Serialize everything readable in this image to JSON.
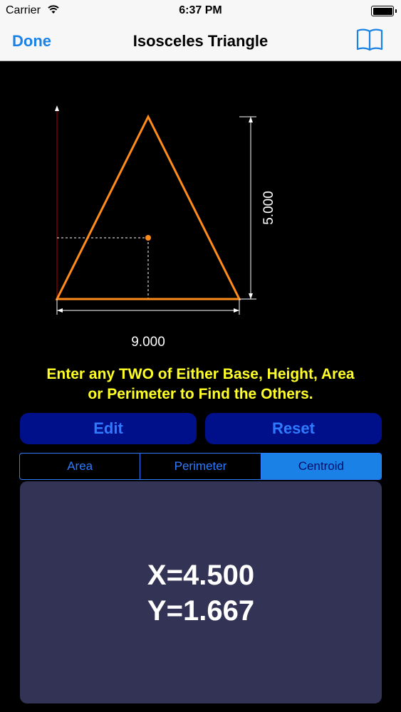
{
  "status": {
    "carrier": "Carrier",
    "time": "6:37 PM"
  },
  "nav": {
    "done_label": "Done",
    "title": "Isosceles Triangle",
    "book_icon": "book-icon"
  },
  "diagram": {
    "base_label": "9.000",
    "height_label": "5.000",
    "triangle_color": "#ff8c1a",
    "centroid_color": "#ff8c1a"
  },
  "instructions": {
    "line1": "Enter any TWO of Either Base, Height, Area",
    "line2": "or Perimeter to Find the Others."
  },
  "buttons": {
    "edit_label": "Edit",
    "reset_label": "Reset"
  },
  "segments": {
    "items": [
      "Area",
      "Perimeter",
      "Centroid"
    ],
    "selected": "Centroid"
  },
  "result": {
    "x_text": "X=4.500",
    "y_text": "Y=1.667"
  },
  "colors": {
    "accent": "#1a82e6",
    "instructions": "#ffff26",
    "button_bg": "#00108a",
    "panel_bg": "#333355"
  }
}
